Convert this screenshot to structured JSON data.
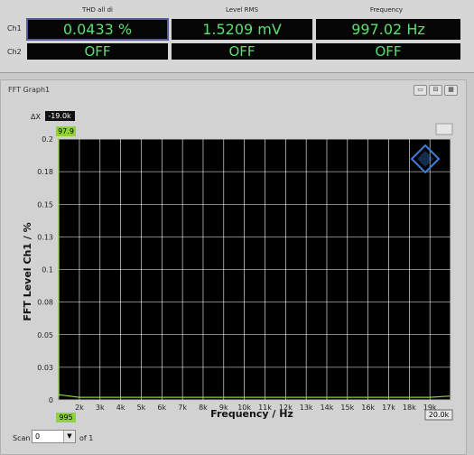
{
  "meters": {
    "columns": [
      "THD all di",
      "Level RMS",
      "Frequency"
    ],
    "rows": [
      {
        "label": "Ch1",
        "values": [
          "0.0433 %",
          "1.5209 mV",
          "997.02 Hz"
        ]
      },
      {
        "label": "Ch2",
        "values": [
          "OFF",
          "OFF",
          "OFF"
        ]
      }
    ]
  },
  "graph_window": {
    "title": "FFT Graph1",
    "scan_label": "Scan",
    "scan_value": "0",
    "scan_of": "of 1"
  },
  "colors": {
    "trace": "#8fd23a",
    "plot_bg": "#000000",
    "grid": "#ffffff",
    "readout_text": "#59e070",
    "logo": "#3d7fd6"
  },
  "chart_data": {
    "type": "line",
    "ylabel": "FFT Level Ch1 / %",
    "xlabel": "Frequency / Hz",
    "ylim": [
      0,
      0.2
    ],
    "xlim": [
      995,
      20000
    ],
    "yticks": [
      "0.2",
      "0.18",
      "0.15",
      "0.13",
      "0.1",
      "0.08",
      "0.05",
      "0.03",
      "0"
    ],
    "xticks": [
      "2k",
      "3k",
      "4k",
      "5k",
      "6k",
      "7k",
      "8k",
      "9k",
      "10k",
      "11k",
      "12k",
      "13k",
      "14k",
      "15k",
      "16k",
      "17k",
      "18k",
      "19k",
      "20k"
    ],
    "cursor": {
      "delta_label": "ΔX",
      "delta_value": "-19.0k",
      "y_readout": "97.9",
      "x_start": "995",
      "x_end": "20.0k"
    },
    "grid": true,
    "series": [
      {
        "color": "#8fd23a",
        "x": [
          995,
          997,
          1000,
          1500,
          2000,
          3000,
          4000,
          5000,
          6000,
          7000,
          8000,
          9000,
          10000,
          11000,
          12000,
          13000,
          14000,
          15000,
          16000,
          17000,
          18000,
          19000,
          20000
        ],
        "y": [
          0.003,
          0.2,
          0.004,
          0.003,
          0.002,
          0.002,
          0.002,
          0.002,
          0.002,
          0.002,
          0.002,
          0.002,
          0.002,
          0.002,
          0.002,
          0.002,
          0.002,
          0.002,
          0.002,
          0.002,
          0.002,
          0.002,
          0.003
        ]
      }
    ]
  }
}
